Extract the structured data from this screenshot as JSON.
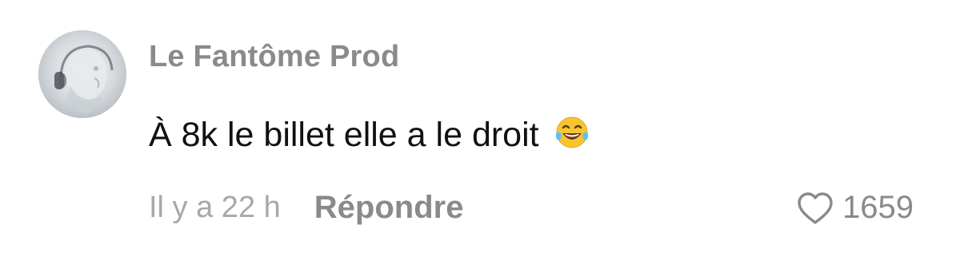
{
  "comment": {
    "username": "Le Fantôme Prod",
    "text": "À 8k le billet elle a le droit",
    "emoji": "face-with-tears-of-joy-icon",
    "timestamp": "Il y a 22 h",
    "reply_label": "Répondre",
    "like_count": "1659"
  },
  "colors": {
    "username": "#8a8a8a",
    "text": "#111111",
    "muted": "#a8a8a8"
  }
}
